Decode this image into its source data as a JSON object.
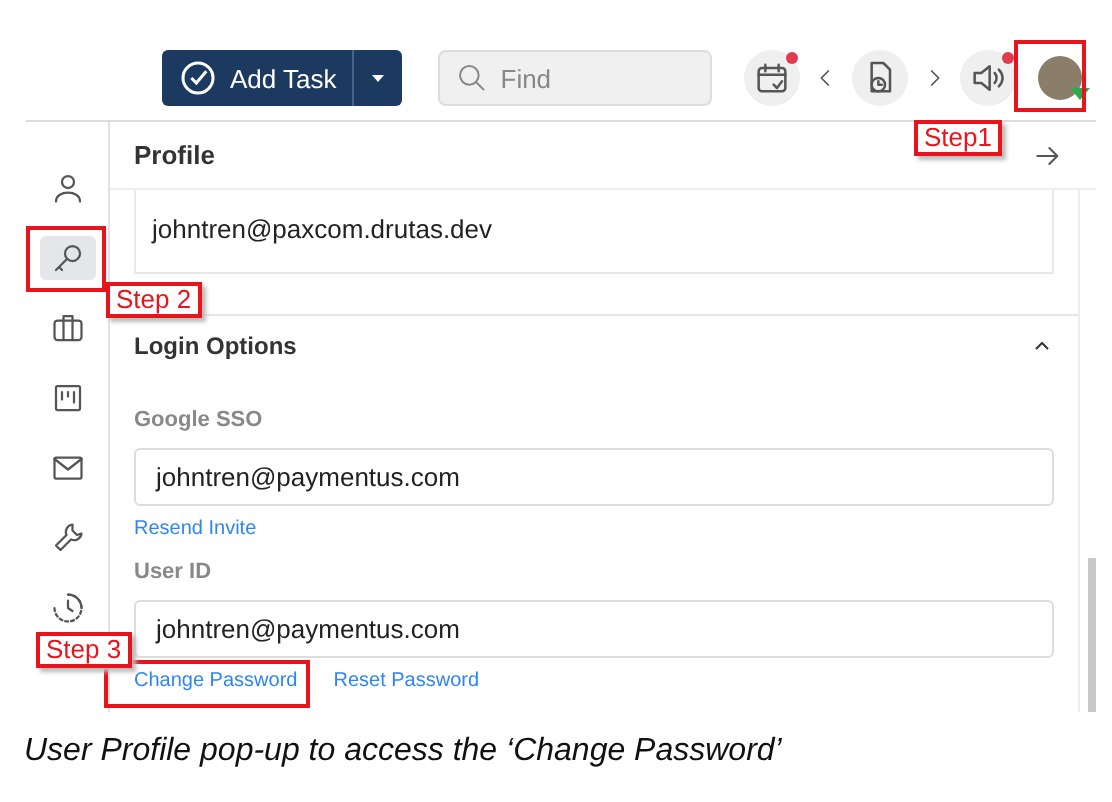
{
  "toolbar": {
    "add_task": {
      "label": "Add Task"
    },
    "search": {
      "placeholder": "Find"
    },
    "icons": [
      {
        "kind": "calendar",
        "badge": true
      },
      {
        "kind": "prev"
      },
      {
        "kind": "timesheet",
        "badge": false
      },
      {
        "kind": "next"
      },
      {
        "kind": "speaker",
        "badge": true
      },
      {
        "kind": "avatar"
      }
    ]
  },
  "sidebar": {
    "items": [
      {
        "kind": "person",
        "selected": false
      },
      {
        "kind": "key",
        "selected": true
      },
      {
        "kind": "briefcase",
        "selected": false
      },
      {
        "kind": "board",
        "selected": false
      },
      {
        "kind": "mail",
        "selected": false
      },
      {
        "kind": "wrench",
        "selected": false
      },
      {
        "kind": "history",
        "selected": false
      }
    ]
  },
  "profile": {
    "title": "Profile",
    "email": "johntren@paxcom.drutas.dev"
  },
  "login_options": {
    "title": "Login Options",
    "expanded": true,
    "fields": [
      {
        "label": "Google SSO",
        "value": "johntren@paymentus.com",
        "links": [
          "Resend Invite"
        ]
      },
      {
        "label": "User ID",
        "value": "johntren@paymentus.com",
        "links": [
          "Change Password",
          "Reset Password"
        ]
      }
    ]
  },
  "annotations": [
    {
      "kind": "avatar",
      "label": "Step1"
    },
    {
      "kind": "sidebar",
      "label": "Step 2"
    },
    {
      "kind": "link",
      "label": "Step 3"
    }
  ],
  "caption": "User Profile pop-up to access the ‘Change Password’"
}
